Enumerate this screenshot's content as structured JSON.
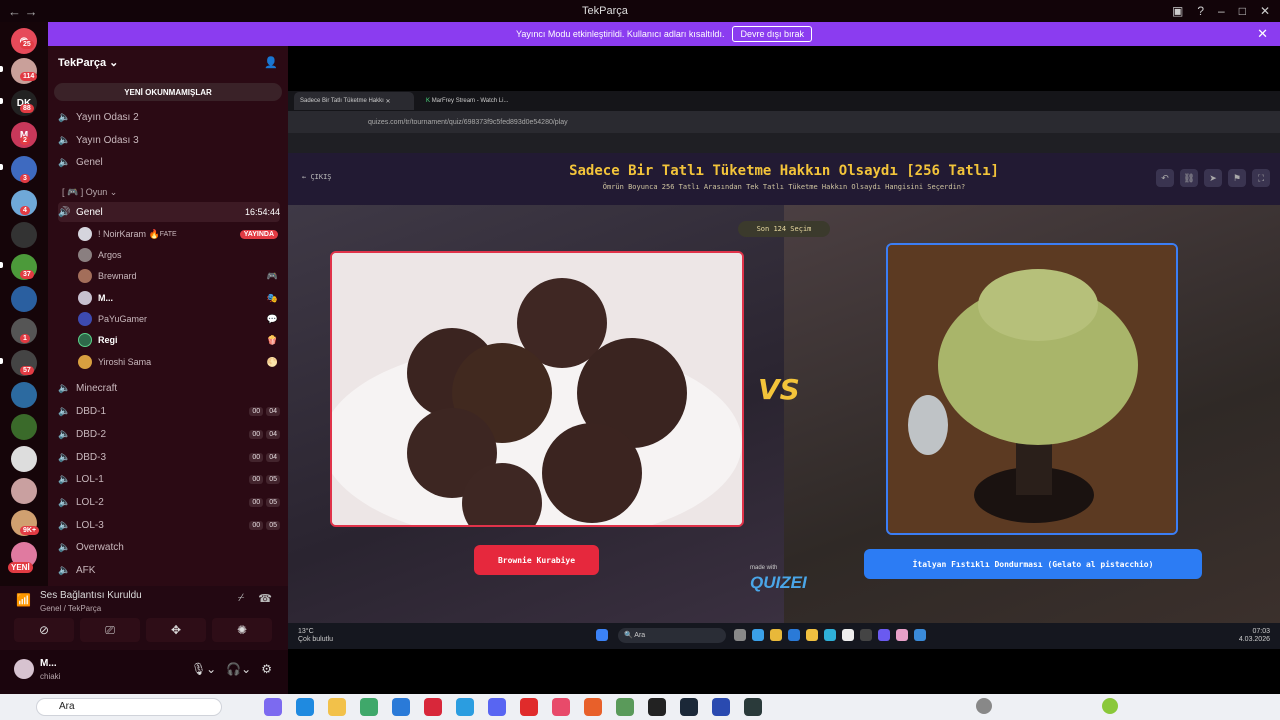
{
  "window": {
    "title": "TekParça",
    "nav": "←   →"
  },
  "banner": {
    "text": "Yayıncı Modu etkinleştirildi. Kullanıcı adları kısaltıldı.",
    "button": "Devre dışı bırak"
  },
  "rail": {
    "badges": [
      "25",
      "114",
      "88",
      "2",
      "3",
      "4",
      "37",
      "1",
      "57",
      "9K+"
    ],
    "new_label": "YENİ"
  },
  "sidebar": {
    "server_name": "TekParça",
    "unread_button": "YENİ OKUNMAMIŞLAR",
    "channels_top": [
      "Yayın Odası 2",
      "Yayın Odası 3",
      "Genel"
    ],
    "category": "[ 🎮 ] Oyun",
    "active_channel": {
      "name": "Genel",
      "time": "16:54:44"
    },
    "members": [
      {
        "name": "! NoirKaram",
        "tag": "FATE",
        "badge": "YAYINDA",
        "color": "#d5d5dd"
      },
      {
        "name": "Argos",
        "color": "#8a7f80"
      },
      {
        "name": "Brewnard",
        "color": "#a36e5a"
      },
      {
        "name": "M...",
        "color": "#c7c0cf"
      },
      {
        "name": "PaYuGamer",
        "color": "#3d4ab0"
      },
      {
        "name": "Regi",
        "color": "#2e6a4a"
      },
      {
        "name": "Yiroshi Sama",
        "color": "#d8a040"
      }
    ],
    "channels_bottom": [
      {
        "name": "Minecraft"
      },
      {
        "name": "DBD-1",
        "tags": [
          "00",
          "04"
        ]
      },
      {
        "name": "DBD-2",
        "tags": [
          "00",
          "04"
        ]
      },
      {
        "name": "DBD-3",
        "tags": [
          "00",
          "04"
        ]
      },
      {
        "name": "LOL-1",
        "tags": [
          "00",
          "05"
        ]
      },
      {
        "name": "LOL-2",
        "tags": [
          "00",
          "05"
        ]
      },
      {
        "name": "LOL-3",
        "tags": [
          "00",
          "05"
        ]
      },
      {
        "name": "Overwatch"
      },
      {
        "name": "AFK"
      }
    ]
  },
  "voice": {
    "title": "Ses Bağlantısı Kuruldu",
    "subtitle": "Genel / TekParça"
  },
  "user": {
    "name": "M...",
    "status": "chiaki"
  },
  "browser": {
    "tabs": [
      "Sadece Bir Tatlı Tüketme Hakkı",
      "MarFrey Stream - Watch Li..."
    ],
    "url": "quizes.com/tr/tournament/quiz/698373f9c5fed893d0e54280/play"
  },
  "quiz": {
    "exit": "ÇIKIŞ",
    "title": "Sadece Bir Tatlı Tüketme Hakkın Olsaydı [256 Tatlı]",
    "subtitle": "Ömrün Boyunca 256 Tatlı Arasından Tek Tatlı Tüketme Hakkın Olsaydı Hangisini Seçerdin?",
    "last": "Son 124 Seçim",
    "vs": "VS",
    "left": "Brownie Kurabiye",
    "right": "İtalyan Fıstıklı Dondurması (Gelato al pistacchio)",
    "made_with": "made with",
    "brand": "QUIZEI"
  },
  "stream_taskbar": {
    "temp": "13°C",
    "weather": "Çok bulutlu",
    "search": "Ara",
    "time": "07:03",
    "date": "4.03.2026"
  },
  "taskbar": {
    "search": "Ara"
  }
}
